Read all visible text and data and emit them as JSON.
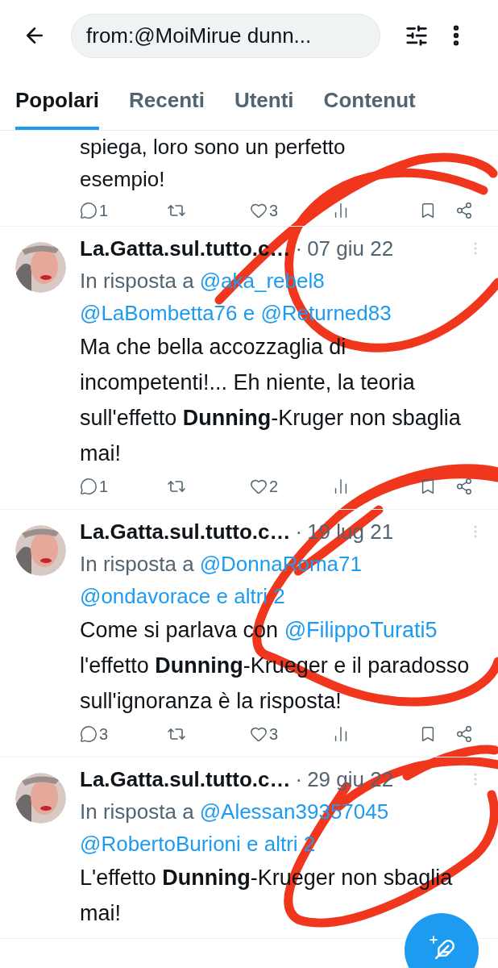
{
  "search": {
    "value": "from:@MoiMirue dunn..."
  },
  "tabs": [
    {
      "label": "Popolari",
      "selected": true
    },
    {
      "label": "Recenti",
      "selected": false
    },
    {
      "label": "Utenti",
      "selected": false
    },
    {
      "label": "Contenut",
      "selected": false
    }
  ],
  "partial_tweet": {
    "lines": [
      "spiega, loro sono un perfetto",
      "esempio!"
    ],
    "replies": "1",
    "likes": "3"
  },
  "tweets": [
    {
      "author": "La.Gatta.sul.tutto.c…",
      "separator": "·",
      "date": "07 giu 22",
      "reply_prefix": "In risposta a",
      "reply_to": [
        "@aka_rebel8",
        "@LaBombetta76 e @Returned83"
      ],
      "body": [
        {
          "kind": "text",
          "text": "Ma che bella accozzaglia di incompetenti!... Eh niente, la teoria sull'effetto **Dunning**-Kruger non sbaglia mai!"
        }
      ],
      "replies": "1",
      "likes": "2"
    },
    {
      "author": "La.Gatta.sul.tutto.c…",
      "separator": "·",
      "date": "19 lug 21",
      "reply_prefix": "In risposta a",
      "reply_to": [
        "@DonnaRoma71",
        "@ondavorace e altri 2"
      ],
      "body": [
        {
          "kind": "text",
          "text": "Come si parlava con "
        },
        {
          "kind": "mention",
          "text": "@FilippoTurati5"
        },
        {
          "kind": "text",
          "text": " l'effetto **Dunning**-Krueger e il paradosso sull'ignoranza è la risposta!"
        }
      ],
      "replies": "3",
      "likes": "3"
    },
    {
      "author": "La.Gatta.sul.tutto.c…",
      "separator": "·",
      "date": "29 giu 22",
      "reply_prefix": "In risposta a",
      "reply_to": [
        "@Alessan39357045",
        "@RobertoBurioni e altri 2"
      ],
      "body": [
        {
          "kind": "text",
          "text": "L'effetto **Dunning**-Krueger non sbaglia mai!"
        }
      ]
    }
  ]
}
